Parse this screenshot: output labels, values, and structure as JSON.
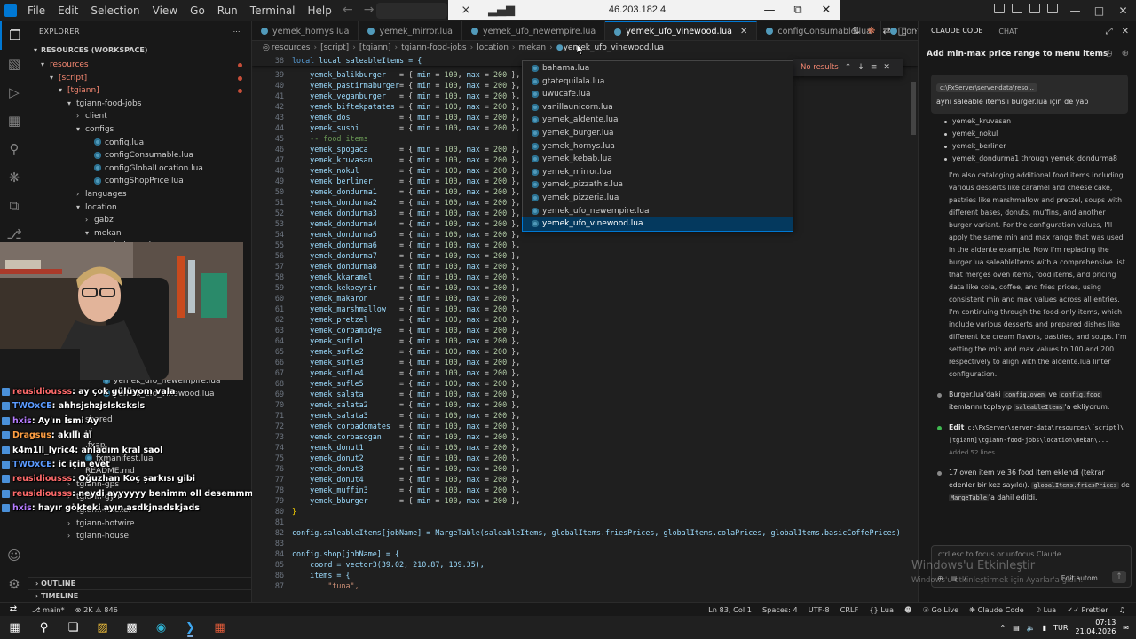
{
  "titlebar": {
    "menu": [
      "File",
      "Edit",
      "Selection",
      "View",
      "Go",
      "Run",
      "Terminal",
      "Help"
    ],
    "remote_ip": "46.203.182.4"
  },
  "explorer": {
    "header": "EXPLORER",
    "workspace": "RESOURCES (WORKSPACE)",
    "tree": [
      {
        "label": "resources",
        "indent": 1,
        "type": "folder-open",
        "red": true,
        "dot": true
      },
      {
        "label": "[script]",
        "indent": 2,
        "type": "folder-open",
        "red": true,
        "dot": true
      },
      {
        "label": "[tgiann]",
        "indent": 3,
        "type": "folder-open",
        "red": true,
        "dot": true
      },
      {
        "label": "tgiann-food-jobs",
        "indent": 4,
        "type": "folder-open"
      },
      {
        "label": "client",
        "indent": 5,
        "type": "folder"
      },
      {
        "label": "configs",
        "indent": 5,
        "type": "folder-open"
      },
      {
        "label": "config.lua",
        "indent": 6,
        "type": "lua"
      },
      {
        "label": "configConsumable.lua",
        "indent": 6,
        "type": "lua"
      },
      {
        "label": "configGlobalLocation.lua",
        "indent": 6,
        "type": "lua"
      },
      {
        "label": "configShopPrice.lua",
        "indent": 6,
        "type": "lua"
      },
      {
        "label": "languages",
        "indent": 5,
        "type": "folder"
      },
      {
        "label": "location",
        "indent": 5,
        "type": "folder-open"
      },
      {
        "label": "gabz",
        "indent": 6,
        "type": "folder"
      },
      {
        "label": "mekan",
        "indent": 6,
        "type": "folder-open"
      },
      {
        "label": "bahama.lua",
        "indent": 7,
        "type": "lua"
      }
    ],
    "tree_lower": [
      {
        "label": "yemek_ufo_newempire.lua",
        "indent": 7,
        "type": "lua"
      },
      {
        "label": "yemek_ufo_vinewood.lua",
        "indent": 7,
        "type": "lua"
      },
      {
        "label": "server",
        "indent": 5,
        "type": "folder"
      },
      {
        "label": "shared",
        "indent": 5,
        "type": "folder"
      },
      {
        "label": "ui",
        "indent": 5,
        "type": "folder"
      },
      {
        "label": ".fxap",
        "indent": 5,
        "type": "file"
      },
      {
        "label": "fxmanifest.lua",
        "indent": 5,
        "type": "lua"
      },
      {
        "label": "README.md",
        "indent": 5,
        "type": "file"
      },
      {
        "label": "tgiann-gps",
        "indent": 4,
        "type": "folder"
      },
      {
        "label": "tgiann-gym",
        "indent": 4,
        "type": "folder"
      },
      {
        "label": "tgiann-hacker",
        "indent": 4,
        "type": "folder"
      },
      {
        "label": "tgiann-hotwire",
        "indent": 4,
        "type": "folder"
      },
      {
        "label": "tgiann-house",
        "indent": 4,
        "type": "folder"
      }
    ],
    "outline": "OUTLINE",
    "timeline": "TIMELINE"
  },
  "chat": [
    {
      "user": "reusidiousss",
      "color": "#ff6b6b",
      "text": ": ay çok gülüyom vala"
    },
    {
      "user": "TWOxCE",
      "color": "#5b9bff",
      "text": ": ahhsjshzjslsksksls"
    },
    {
      "user": "hxis",
      "color": "#b67cff",
      "text": ": Ay'ın İsmi Ay"
    },
    {
      "user": "Dragsus",
      "color": "#ff9f43",
      "text": ": akıllı al"
    },
    {
      "user": "k4m1ll_lyric4",
      "color": "#ffffff",
      "text": ": anladım kral saol"
    },
    {
      "user": "TWOxCE",
      "color": "#5b9bff",
      "text": ": ic için evet"
    },
    {
      "user": "reusidiousss",
      "color": "#ff6b6b",
      "text": ": Oğuzhan Koç şarkısı gibi"
    },
    {
      "user": "reusidiousss",
      "color": "#ff6b6b",
      "text": ": neydi ayyyyyy benimm oll desemmm mi"
    },
    {
      "user": "hxis",
      "color": "#b67cff",
      "text": ": hayır gökteki ayın asdkjnadskjads"
    }
  ],
  "tabs": [
    {
      "label": "yemek_hornys.lua",
      "active": false
    },
    {
      "label": "yemek_mirror.lua",
      "active": false
    },
    {
      "label": "yemek_ufo_newempire.lua",
      "active": false
    },
    {
      "label": "yemek_ufo_vinewood.lua",
      "active": true
    },
    {
      "label": "configConsumable.lua",
      "active": false
    },
    {
      "label": "configGl",
      "active": false
    }
  ],
  "breadcrumb": [
    "resources",
    "[script]",
    "[tgiann]",
    "tgiann-food-jobs",
    "location",
    "mekan",
    "yemek_ufo_vinewood.lua"
  ],
  "find": {
    "status": "No results"
  },
  "dropdown": [
    "bahama.lua",
    "gtatequilala.lua",
    "uwucafe.lua",
    "vanillaunicorn.lua",
    "yemek_aldente.lua",
    "yemek_burger.lua",
    "yemek_hornys.lua",
    "yemek_kebab.lua",
    "yemek_mirror.lua",
    "yemek_pizzathis.lua",
    "yemek_pizzeria.lua",
    "yemek_ufo_newempire.lua",
    "yemek_ufo_vinewood.lua"
  ],
  "editor": {
    "sticky": "local saleableItems = {",
    "item_lines": [
      {
        "n": 39,
        "name": "yemek_balikburger"
      },
      {
        "n": 40,
        "name": "yemek_pastirmaburger"
      },
      {
        "n": 41,
        "name": "yemek_veganburger"
      },
      {
        "n": 42,
        "name": "yemek_biftekpatates"
      },
      {
        "n": 43,
        "name": "yemek_dos"
      },
      {
        "n": 44,
        "name": "yemek_sushi"
      },
      {
        "n": 45,
        "comment": "-- food items"
      },
      {
        "n": 46,
        "name": "yemek_spogaca"
      },
      {
        "n": 47,
        "name": "yemek_kruvasan"
      },
      {
        "n": 48,
        "name": "yemek_nokul"
      },
      {
        "n": 49,
        "name": "yemek_berliner"
      },
      {
        "n": 50,
        "name": "yemek_dondurma1"
      },
      {
        "n": 51,
        "name": "yemek_dondurma2"
      },
      {
        "n": 52,
        "name": "yemek_dondurma3"
      },
      {
        "n": 53,
        "name": "yemek_dondurma4"
      },
      {
        "n": 54,
        "name": "yemek_dondurma5"
      },
      {
        "n": 55,
        "name": "yemek_dondurma6"
      },
      {
        "n": 56,
        "name": "yemek_dondurma7"
      },
      {
        "n": 57,
        "name": "yemek_dondurma8"
      },
      {
        "n": 58,
        "name": "yemek_kkaramel"
      },
      {
        "n": 59,
        "name": "yemek_kekpeynir"
      },
      {
        "n": 60,
        "name": "yemek_makaron"
      },
      {
        "n": 61,
        "name": "yemek_marshmallow"
      },
      {
        "n": 62,
        "name": "yemek_pretzel"
      },
      {
        "n": 63,
        "name": "yemek_corbamidye"
      },
      {
        "n": 64,
        "name": "yemek_sufle1"
      },
      {
        "n": 65,
        "name": "yemek_sufle2"
      },
      {
        "n": 66,
        "name": "yemek_sufle3"
      },
      {
        "n": 67,
        "name": "yemek_sufle4"
      },
      {
        "n": 68,
        "name": "yemek_sufle5"
      },
      {
        "n": 69,
        "name": "yemek_salata"
      },
      {
        "n": 70,
        "name": "yemek_salata2"
      },
      {
        "n": 71,
        "name": "yemek_salata3"
      },
      {
        "n": 72,
        "name": "yemek_corbadomates"
      },
      {
        "n": 73,
        "name": "yemek_corbasogan"
      },
      {
        "n": 74,
        "name": "yemek_donut1"
      },
      {
        "n": 75,
        "name": "yemek_donut2"
      },
      {
        "n": 76,
        "name": "yemek_donut3"
      },
      {
        "n": 77,
        "name": "yemek_donut4"
      },
      {
        "n": 78,
        "name": "yemek_muffin3"
      },
      {
        "n": 79,
        "name": "yemek_bburger"
      }
    ],
    "min": "100",
    "max": "200",
    "line80": "}",
    "line82": "config.saleableItems[jobName] = MargeTable(saleableItems, globalItems.friesPrices, globalItems.colaPrices, globalItems.basicCoffePrices)",
    "line84": "config.shop[jobName] = {",
    "line85": "coord = vector3(39.02, 210.87, 109.35),",
    "line86": "items = {",
    "line87": "\"tuna\","
  },
  "claude": {
    "tabs": [
      "CLAUDE CODE",
      "CHAT"
    ],
    "title": "Add min-max price range to menu items",
    "user_path": "c:\\FxServer\\server-data\\reso...",
    "user_msg": "aynı saleable items'ı burger.lua için de yap",
    "list_items": [
      "yemek_kruvasan",
      "yemek_nokul",
      "yemek_berliner",
      "yemek_dondurma1 through yemek_dondurma8"
    ],
    "thinking": "I'm also cataloging additional food items including various desserts like caramel and cheese cake, pastries like marshmallow and pretzel, soups with different bases, donuts, muffins, and another burger variant. For the configuration values, I'll apply the same min and max range that was used in the aldente example. Now I'm replacing the burger.lua saleableItems with a comprehensive list that merges oven items, food items, and pricing data like cola, coffee, and fries prices, using consistent min and max values across all entries. I'm continuing through the food-only items, which include various desserts and prepared dishes like different ice cream flavors, pastries, and soups. I'm setting the min and max values to 100 and 200 respectively to align with the aldente.lua linter configuration.",
    "step1_a": "Burger.lua'daki",
    "step1_c1": "config.oven",
    "step1_b": "ve",
    "step1_c2": "config.food",
    "step1_d": "itemlarını toplayıp",
    "step1_c3": "saleableItems",
    "step1_e": "'a ekliyorum.",
    "edit_label": "Edit",
    "edit_path": "c:\\FxServer\\server-data\\resources\\[script]\\[tgiann]\\tgiann-food-jobs\\location\\mekan\\...",
    "edit_sub": "Added 52 lines",
    "step3_a": "17 oven item ve 36 food item eklendi (tekrar edenler bir kez sayıldı).",
    "step3_c1": "globalItems.friesPrices",
    "step3_b": "de",
    "step3_c2": "MargeTable",
    "step3_c": "'a dahil edildi.",
    "input_placeholder": "ctrl esc to focus or unfocus Claude",
    "auto_label": "Edit autom..."
  },
  "watermark": {
    "line1": "Windows'u Etkinleştir",
    "line2": "Windows'u etkinleştirmek için Ayarlar'a gidin."
  },
  "status": {
    "branch": "main*",
    "problems": "2K",
    "warnings": "846",
    "position": "Ln 83, Col 1",
    "spaces": "Spaces: 4",
    "encoding": "UTF-8",
    "eol": "CRLF",
    "language": "Lua",
    "golive": "Go Live",
    "claude": "Claude Code",
    "lua2": "Lua",
    "prettier": "Prettier"
  },
  "taskbar": {
    "lang": "TUR",
    "time": "07:13",
    "date": "21.04.2026"
  }
}
